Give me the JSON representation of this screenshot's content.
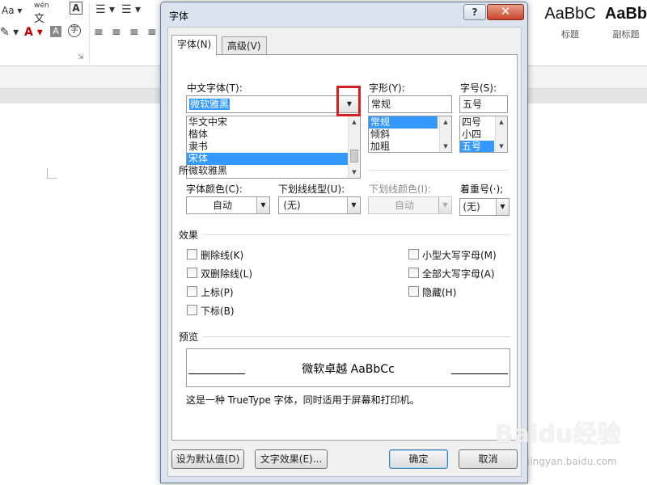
{
  "ribbon": {
    "font_name_fragment": "Aa",
    "phonetic_guide": "wén",
    "styles": [
      {
        "sample": "AaBbC",
        "name": "标题"
      },
      {
        "sample": "AaBb",
        "name": "副标题"
      }
    ]
  },
  "dialog": {
    "title": "字体",
    "help_label": "?",
    "close_label": "✕",
    "tabs": [
      "字体(N)",
      "高级(V)"
    ],
    "chinese_font": {
      "label": "中文字体(T):",
      "value": "微软雅黑",
      "list": [
        "华文中宋",
        "楷体",
        "隶书",
        "宋体",
        "微软雅黑"
      ],
      "selected_index": 3
    },
    "western_font_label_fragment": "所",
    "style": {
      "label": "字形(Y):",
      "value": "常规",
      "list": [
        "常规",
        "倾斜",
        "加粗"
      ],
      "selected_index": 0
    },
    "size": {
      "label": "字号(S):",
      "value": "五号",
      "list": [
        "四号",
        "小四",
        "五号"
      ],
      "selected_index": 2
    },
    "font_color": {
      "label": "字体颜色(C):",
      "value": "自动"
    },
    "underline_style": {
      "label": "下划线线型(U):",
      "value": "(无)"
    },
    "underline_color": {
      "label": "下划线颜色(I):",
      "value": "自动"
    },
    "emphasis": {
      "label": "着重号(·);",
      "value": "(无)"
    },
    "effects": {
      "title": "效果",
      "left": [
        "删除线(K)",
        "双删除线(L)",
        "上标(P)",
        "下标(B)"
      ],
      "right": [
        "小型大写字母(M)",
        "全部大写字母(A)",
        "隐藏(H)"
      ]
    },
    "preview": {
      "title": "预览",
      "sample": "微软卓越  AaBbCc",
      "note": "这是一种 TrueType 字体，同时适用于屏幕和打印机。"
    },
    "buttons": {
      "set_default": "设为默认值(D)",
      "text_effects": "文字效果(E)...",
      "ok": "确定",
      "cancel": "取消"
    }
  },
  "watermark": {
    "text": "Baidu经验",
    "sub": "jingyan.baidu.com"
  },
  "colors": {
    "selection": "#3399ff",
    "highlight_box": "#d42020",
    "close_button": "#c7452a"
  }
}
